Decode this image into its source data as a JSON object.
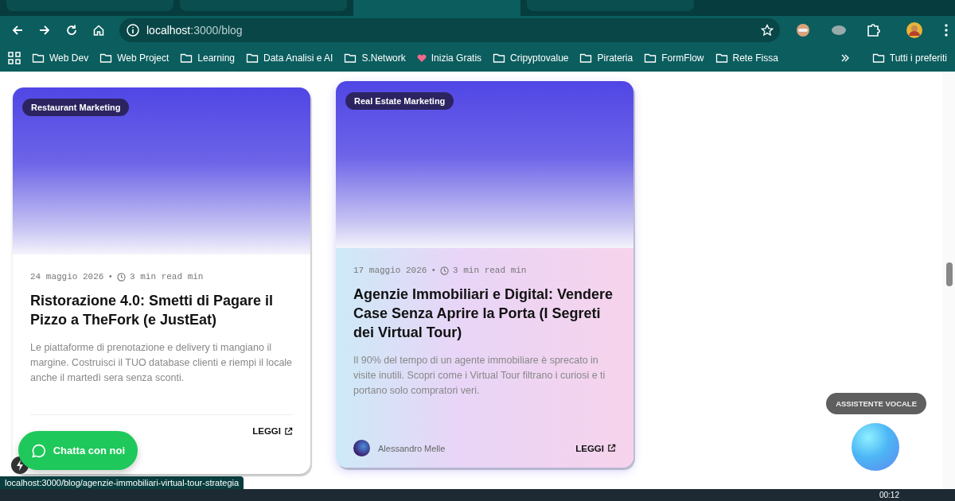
{
  "browser": {
    "tabs": [
      {
        "selected": false
      },
      {
        "selected": false
      },
      {
        "selected": true
      },
      {
        "selected": false
      }
    ],
    "address": {
      "host": "localhost",
      "path": ":3000/blog"
    },
    "bookmarks": [
      {
        "label": "Web Dev",
        "kind": "folder"
      },
      {
        "label": "Web Project",
        "kind": "folder"
      },
      {
        "label": "Learning",
        "kind": "folder"
      },
      {
        "label": "Data Analisi e AI",
        "kind": "folder"
      },
      {
        "label": "S.Network",
        "kind": "folder"
      },
      {
        "label": "Inizia Gratis",
        "kind": "site"
      },
      {
        "label": "Cripyptovalue",
        "kind": "folder"
      },
      {
        "label": "Pirateria",
        "kind": "folder"
      },
      {
        "label": "FormFlow",
        "kind": "folder"
      },
      {
        "label": "Rete Fissa",
        "kind": "folder"
      }
    ],
    "all_bookmarks": "Tutti i preferiti"
  },
  "posts": [
    {
      "category": "Restaurant Marketing",
      "date": "24 maggio 2026",
      "separator": "•",
      "read_time": "3 min read min",
      "title": "Ristorazione 4.0: Smetti di Pagare il Pizzo a TheFork (e JustEat)",
      "excerpt": "Le piattaforme di prenotazione e delivery ti mangiano il margine. Costruisci il TUO database clienti e riempi il locale anche il martedì sera senza sconti.",
      "link": "LEGGI",
      "hovered": false
    },
    {
      "category": "Real Estate Marketing",
      "date": "17 maggio 2026",
      "separator": "•",
      "read_time": "3 min read min",
      "title": "Agenzie Immobiliari e Digital: Vendere Case Senza Aprire la Porta (I Segreti dei Virtual Tour)",
      "excerpt": "Il 90% del tempo di un agente immobiliare è sprecato in visite inutili. Scopri come i Virtual Tour filtrano i curiosi e ti portano solo compratori veri.",
      "author": "Alessandro Melle",
      "link": "LEGGI",
      "hovered": true
    }
  ],
  "chat_button": "Chatta con noi",
  "voice_assistant": "ASSISTENTE VOCALE",
  "status_url": "localhost:3000/blog/agenzie-immobiliari-virtual-tour-strategia",
  "taskbar": {
    "time": "00:12"
  }
}
